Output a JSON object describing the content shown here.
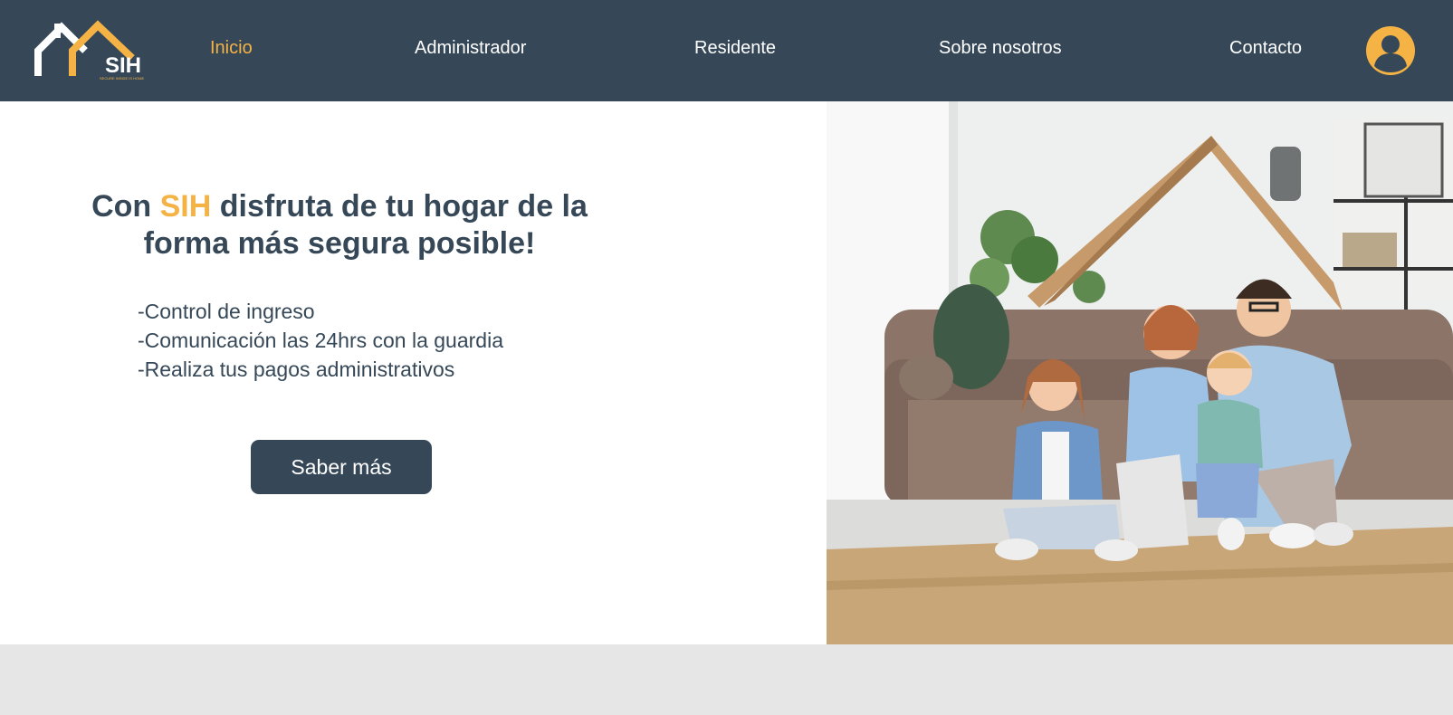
{
  "brand": {
    "logo_text": "SIH",
    "logo_tagline": "SECURE INSIDE IS HOME"
  },
  "nav": {
    "items": [
      {
        "label": "Inicio",
        "active": true
      },
      {
        "label": "Administrador",
        "active": false
      },
      {
        "label": "Residente",
        "active": false
      },
      {
        "label": "Sobre nosotros",
        "active": false
      },
      {
        "label": "Contacto",
        "active": false
      }
    ],
    "user_icon": "user-circle-icon"
  },
  "hero": {
    "headline_prefix": "Con ",
    "headline_accent": "SIH",
    "headline_suffix": " disfruta de tu hogar de la forma más segura posible!",
    "features": [
      "-Control de ingreso",
      "-Comunicación las 24hrs con la guardia",
      "-Realiza tus pagos administrativos"
    ],
    "cta_label": "Saber más",
    "image_alt": "family-under-cardboard-roof-photo"
  },
  "colors": {
    "navbar_bg": "#364857",
    "accent": "#f5b346",
    "text_dark": "#364857",
    "page_bg": "#e6e6e6"
  }
}
